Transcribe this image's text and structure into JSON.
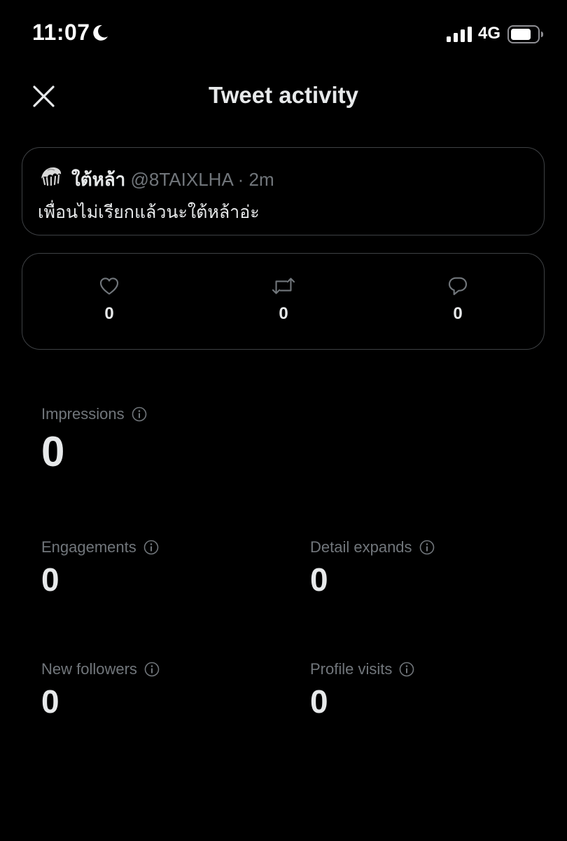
{
  "status_bar": {
    "time": "11:07",
    "network": "4G",
    "icons": [
      "moon-icon",
      "signal-bars-icon",
      "battery-icon"
    ]
  },
  "header": {
    "title": "Tweet activity",
    "close_icon": "close-icon"
  },
  "tweet": {
    "display_name": "ใต้หล้า",
    "handle": "@8TAIXLHA",
    "separator": "·",
    "time": "2m",
    "text": "เพื่อนไม่เรียกแล้วนะใต้หล้าอ่ะ"
  },
  "engagement": {
    "likes": "0",
    "retweets": "0",
    "replies": "0"
  },
  "metrics": {
    "impressions": {
      "label": "Impressions",
      "value": "0"
    },
    "engagements": {
      "label": "Engagements",
      "value": "0"
    },
    "detail_expands": {
      "label": "Detail expands",
      "value": "0"
    },
    "new_followers": {
      "label": "New followers",
      "value": "0"
    },
    "profile_visits": {
      "label": "Profile visits",
      "value": "0"
    }
  },
  "colors": {
    "background": "#000000",
    "primary_text": "#e7e9ea",
    "secondary_text": "#71767b",
    "border": "#3e4144"
  }
}
